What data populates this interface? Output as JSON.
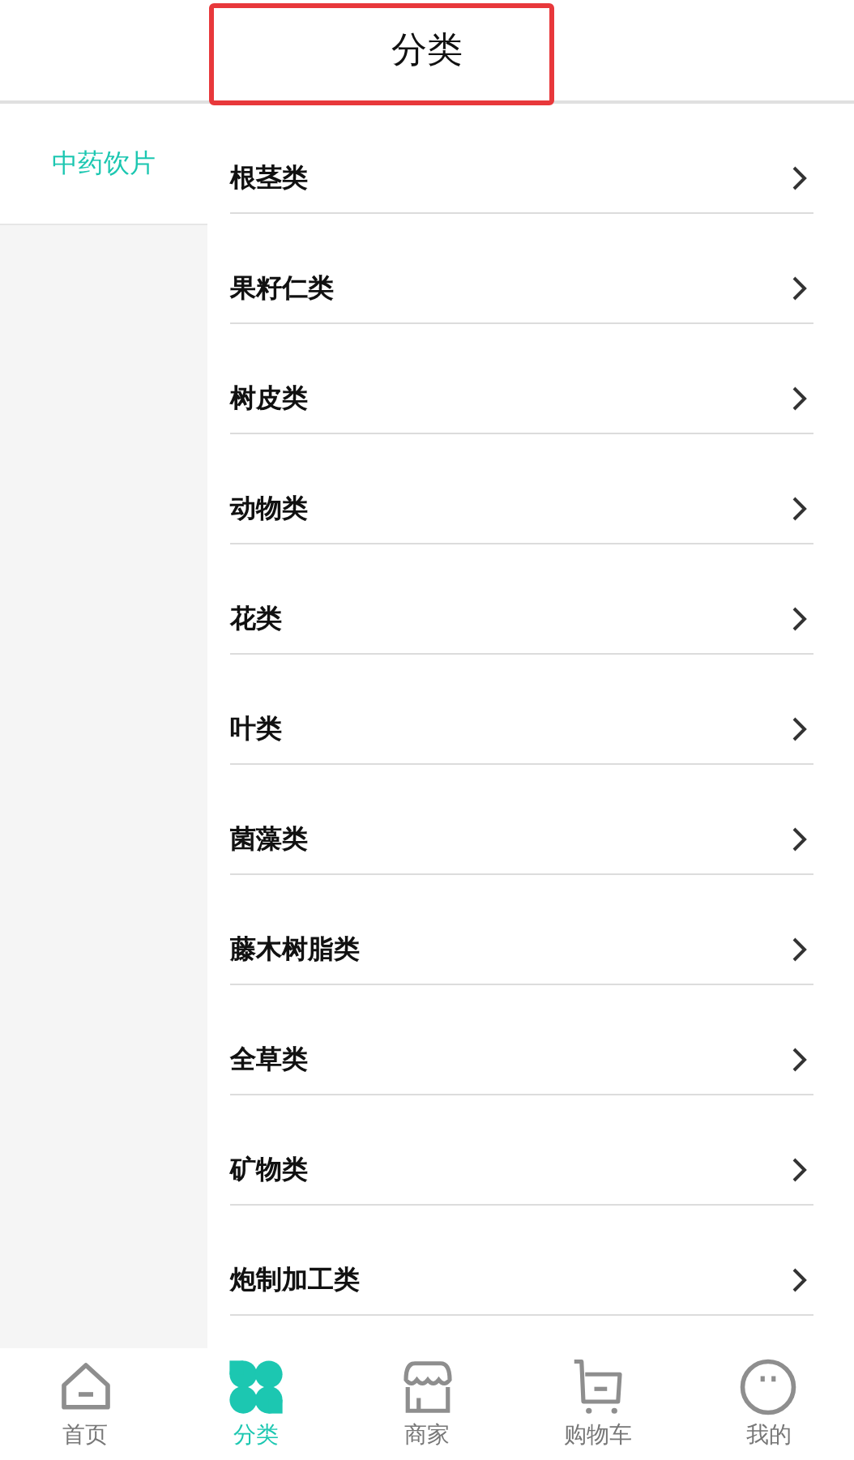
{
  "header": {
    "title": "分类",
    "title_highlighted": true
  },
  "sidebar": {
    "items": [
      {
        "label": "中药饮片",
        "selected": true
      }
    ]
  },
  "categories": [
    {
      "label": "根茎类"
    },
    {
      "label": "果籽仁类"
    },
    {
      "label": "树皮类"
    },
    {
      "label": "动物类"
    },
    {
      "label": "花类"
    },
    {
      "label": "叶类"
    },
    {
      "label": "菌藻类"
    },
    {
      "label": "藤木树脂类"
    },
    {
      "label": "全草类"
    },
    {
      "label": "矿物类"
    },
    {
      "label": "炮制加工类"
    }
  ],
  "tab_bar": [
    {
      "kind": "home",
      "label": "首页",
      "selected": false
    },
    {
      "kind": "category",
      "label": "分类",
      "selected": true
    },
    {
      "kind": "shop",
      "label": "商家",
      "selected": false
    },
    {
      "kind": "cart",
      "label": "购物车",
      "selected": false
    },
    {
      "kind": "profile",
      "label": "我的",
      "selected": false
    }
  ]
}
